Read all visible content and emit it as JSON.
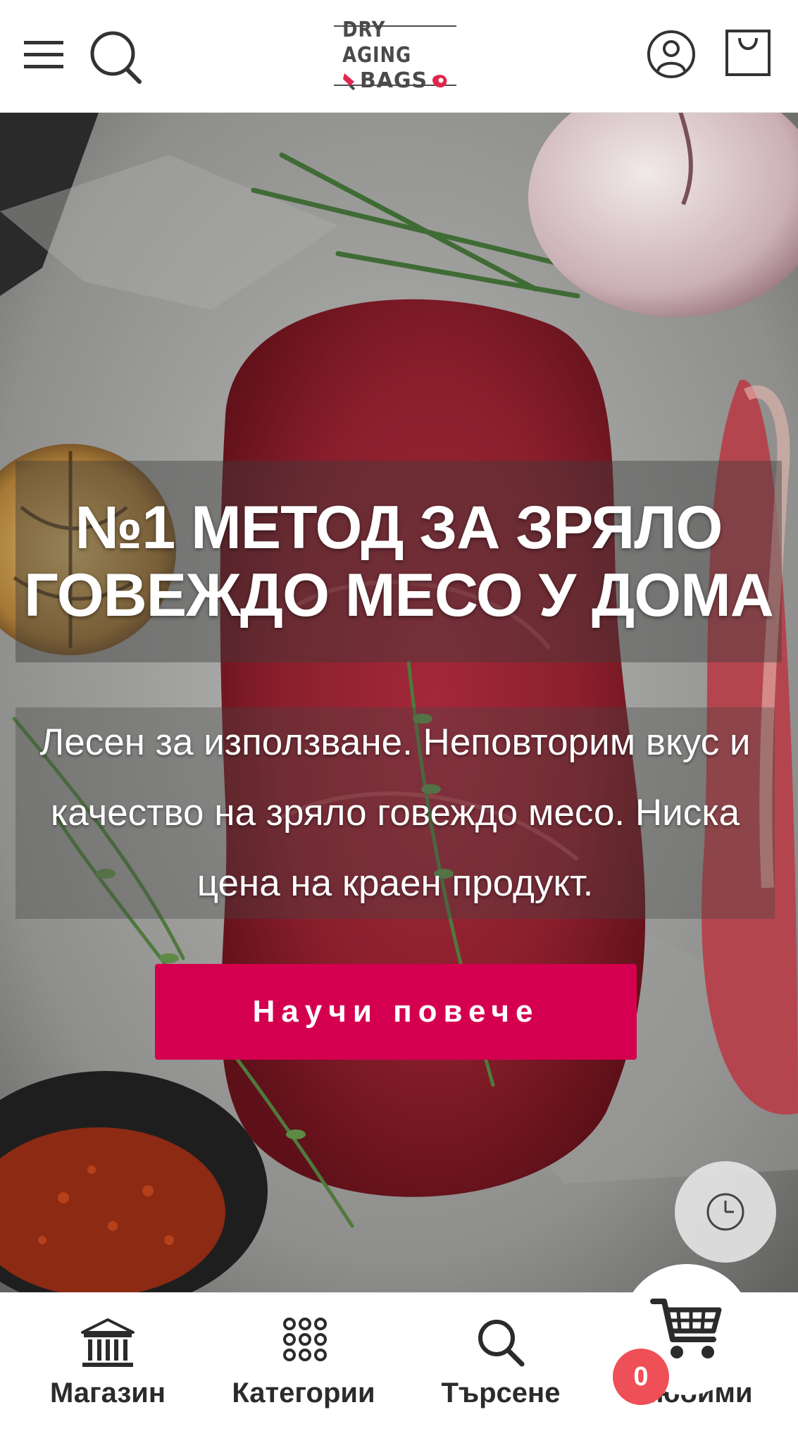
{
  "header": {
    "logo": {
      "line1": "DRY AGING",
      "line2": "BAGS"
    },
    "icons": {
      "menu": "hamburger-icon",
      "search": "search-icon",
      "account": "user-icon",
      "cart": "bag-icon"
    }
  },
  "hero": {
    "title": "№1 МЕТОД ЗА ЗРЯЛО ГОВЕЖДО МЕСО У ДОМА",
    "subtitle": "Лесен за използване. Неповторим вкус и качество на зряло говеждо месо. Ниска цена на краен продукт.",
    "cta_label": "Научи повече",
    "history_icon": "clock-icon"
  },
  "bottom_nav": {
    "items": [
      {
        "label": "Магазин",
        "icon": "bank-icon"
      },
      {
        "label": "Категории",
        "icon": "grid-icon"
      },
      {
        "label": "Търсене",
        "icon": "search-icon"
      },
      {
        "label": "Любими",
        "icon": "heart-icon"
      }
    ],
    "cart_icon": "shopping-cart-icon",
    "cart_count": "0"
  },
  "colors": {
    "accent": "#d4004f",
    "badge": "#ef4f57",
    "header_bg": "#ffffff",
    "text_dark": "#2b2b2b"
  }
}
